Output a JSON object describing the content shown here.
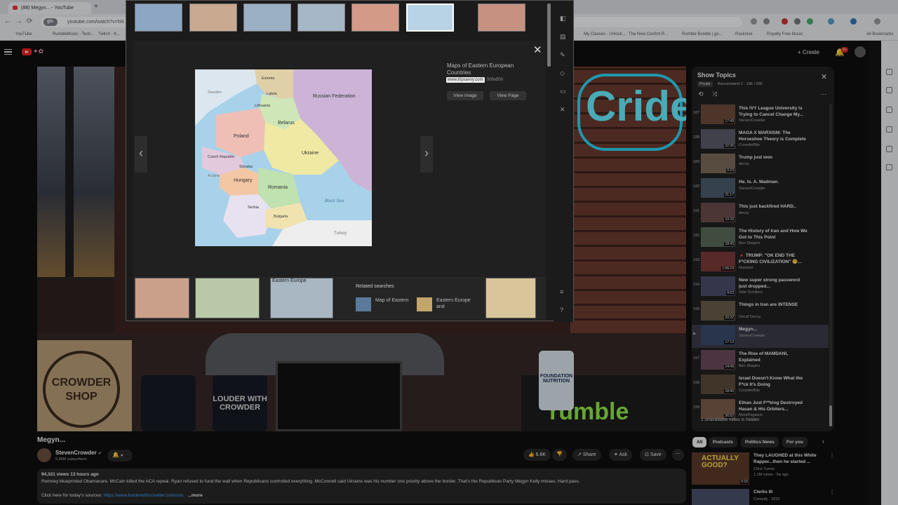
{
  "browser": {
    "tab_title": "(88) Megyn... - YouTube",
    "new_tab": "+",
    "url_chip": "gfs",
    "url": "youtube.com/watch?v=hN",
    "nav_back": "←",
    "nav_forward": "→",
    "nav_reload": "⟳",
    "bookmarks": [
      "YouTube",
      "RumbleMusic - Testi...",
      "Twitch - K...",
      "My Classes - Unlock...",
      "The New Confrnt R...",
      "Rumble Bundle | go...",
      "Rocknive",
      "Royalty Free Music",
      "All Bookmarks"
    ]
  },
  "youtube": {
    "create_label": "Create",
    "notif_count": "9+",
    "video": {
      "neon_text": "Cride",
      "shop_text": "CROWDER SHOP",
      "mug_text": "LOUDER WITH CROWDER",
      "bottle_text": "FOUNDATION NUTRITION",
      "rumble_text": "rumble",
      "title": "Megyn...",
      "channel": "StevenCrowder",
      "verified": "✔",
      "subscribers": "5.86M subscribers",
      "likes": "6.6K",
      "share": "Share",
      "ask": "Ask",
      "save": "Save",
      "more": "⋯",
      "views_time": "94,321 views  13 hours ago",
      "description": "Romney blueprinted Obamacare. McCain killed the ACA repeal. Ryan refused to fund the wall when Republicans controlled everything. McConnell said Ukraine was his number one priority above the border. That's the Republican Party Megyn Kelly misses. Hard pass.",
      "link_label": "Click here for today's sources: ",
      "link": "https://www.louderwithcrowder.com/sou",
      "more_label": "...more"
    },
    "playlist": {
      "title": "Show Topics",
      "privacy": "Private",
      "meta": "Bannerstand 2 · 196 / 200",
      "hidden_note": "1 unavailable video is hidden",
      "items": [
        {
          "num": "187",
          "title": "This IVY League University Is Trying to Cancel Change My...",
          "channel": "StevenCrowder",
          "duration": "17:49"
        },
        {
          "num": "188",
          "title": "MAGA X MARXISM: The Horseshoe Theory is Complete",
          "channel": "CrowderBits",
          "duration": "32:36"
        },
        {
          "num": "189",
          "title": "Trump just won",
          "channel": "decoy",
          "duration": "0:23"
        },
        {
          "num": "190",
          "title": "He. Is. A. Madman.",
          "channel": "StevenCrowder",
          "duration": "21:17"
        },
        {
          "num": "191",
          "title": "This just backfired HARD..",
          "channel": "decoy",
          "duration": "10:33"
        },
        {
          "num": "192",
          "title": "The History of Iran and How We Got to This Point",
          "channel": "Ben Shapiro",
          "duration": "18:43"
        },
        {
          "num": "193",
          "title": "🔺 TRUMP: \"OK END THE F*CKING CIVILIZATION\" 😬...",
          "channel": "Nuxanor",
          "duration": "1:56:24"
        },
        {
          "num": "194",
          "title": "New super strong password just dropped...",
          "channel": "Side Scrollers",
          "duration": "9:03"
        },
        {
          "num": "195",
          "title": "Things in Iran are INTENSE",
          "channel": "Decaf Decoy",
          "duration": "20:22"
        },
        {
          "num": "▶",
          "title": "Megyn...",
          "channel": "StevenCrowder",
          "duration": "17:13"
        },
        {
          "num": "197",
          "title": "The Rise of MAMDANI, Explained",
          "channel": "Ben Shapiro",
          "duration": "14:49"
        },
        {
          "num": "198",
          "title": "Israel Doesn't Know What the F*ck It's Doing",
          "channel": "CrowderBits",
          "duration": "18:40"
        },
        {
          "num": "199",
          "title": "Ethan Just F**king Destroyed Hasan & His Orbiters...",
          "channel": "MorePegasus",
          "duration": "36:52"
        }
      ]
    },
    "chips": [
      "All",
      "Podcasts",
      "Politics News",
      "For you"
    ],
    "suggestions": [
      {
        "title": "They LAUGHED at this White Rapper...then he started ...",
        "channel": "Chris Turner",
        "meta": "1.1M views · 3w ago",
        "duration": "9:16",
        "thumb_text": "ACTUALLY GOOD?"
      },
      {
        "title": "Clerks III",
        "channel": "Comedy · 2022",
        "meta": "",
        "duration": "",
        "thumb_text": ""
      }
    ]
  },
  "viewer": {
    "caption": "Maps of Eastern European Countries",
    "domain": "www.tripsavvy.com",
    "size": "500x500",
    "view_image": "View image",
    "view_page": "View Page",
    "related": "Related searches",
    "related_items": [
      "Map of Eastern",
      "Eastern Europe and"
    ],
    "bottom_label": "Eastern Europe",
    "map_labels": {
      "russia": "Russian Federation",
      "estonia": "Estonia",
      "latvia": "Latvia",
      "lithuania": "Lithuania",
      "belarus": "Belarus",
      "poland": "Poland",
      "ukraine": "Ukraine",
      "czech": "Czech Republic",
      "slovakia": "Slovakia",
      "hungary": "Hungary",
      "romania": "Romania",
      "serbia": "Serbia",
      "bulgaria": "Bulgaria",
      "blacksea": "Black Sea",
      "turkey": "Turkey",
      "sweden": "Sweden",
      "austria": "Austria"
    },
    "colors": {
      "russia": "#cdb4d6",
      "ukraine": "#efe9a3",
      "poland": "#efbfb6",
      "belarus": "#cfe6b8",
      "romania": "#bfe2b0",
      "sea": "#a8d2ea"
    }
  }
}
